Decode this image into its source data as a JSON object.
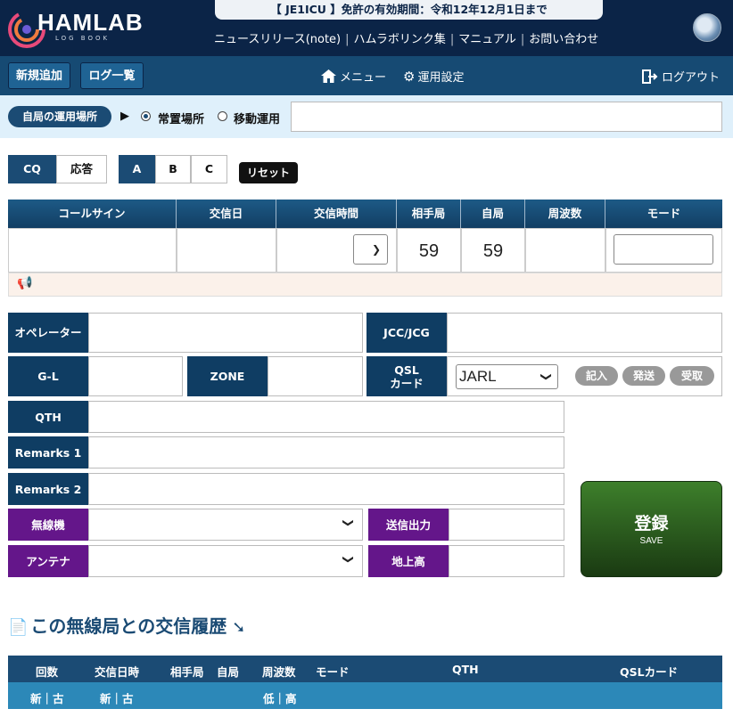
{
  "header": {
    "logo_text": "HAMLAB",
    "logo_sub": "LOG BOOK",
    "license_notice": "【 JE1ICU 】免許の有効期間：令和12年12月1日まで",
    "links": [
      "ニュースリリース(note)",
      "ハムラボリンク集",
      "マニュアル",
      "お問い合わせ"
    ]
  },
  "nav": {
    "new_entry": "新規追加",
    "log_list": "ログ一覧",
    "menu": "メニュー",
    "settings": "運用設定",
    "logout": "ログアウト"
  },
  "location": {
    "badge": "自局の運用場所",
    "arrow": "▶",
    "fixed": "常置場所",
    "mobile": "移動運用",
    "value": ""
  },
  "mode_toggle": {
    "cq": "CQ",
    "answer": "応答",
    "a": "A",
    "b": "B",
    "c": "C",
    "reset": "リセット"
  },
  "qso_table": {
    "headers": [
      "コールサイン",
      "交信日",
      "交信時間",
      "相手局",
      "自局",
      "周波数",
      "モード"
    ],
    "their_rst": "59",
    "my_rst": "59",
    "callsign": "",
    "date": "",
    "time": "",
    "frequency": "",
    "mode": ""
  },
  "fields": {
    "operator": "オペレーター",
    "jcc": "JCC/JCG",
    "gl": "G-L",
    "zone": "ZONE",
    "qsl_card_l1": "QSL",
    "qsl_card_l2": "カード",
    "qsl_value": "JARL",
    "qsl_buttons": [
      "記入",
      "発送",
      "受取"
    ],
    "qth": "QTH",
    "remarks1": "Remarks 1",
    "remarks2": "Remarks 2",
    "radio": "無線機",
    "power": "送信出力",
    "antenna": "アンテナ",
    "height": "地上高"
  },
  "save": {
    "label": "登録",
    "sub": "SAVE"
  },
  "history": {
    "title": "この無線局との交信履歴",
    "headers": [
      "回数",
      "交信日時",
      "相手局",
      "自局",
      "周波数",
      "モード",
      "QTH",
      "QSLカード"
    ],
    "sort_row": [
      "新｜古",
      "新｜古",
      "低｜高"
    ]
  },
  "colors": {
    "navy": "#0b2447",
    "accent": "#1b4b74",
    "purple": "#64168a",
    "save_green": "#2f6b22"
  }
}
